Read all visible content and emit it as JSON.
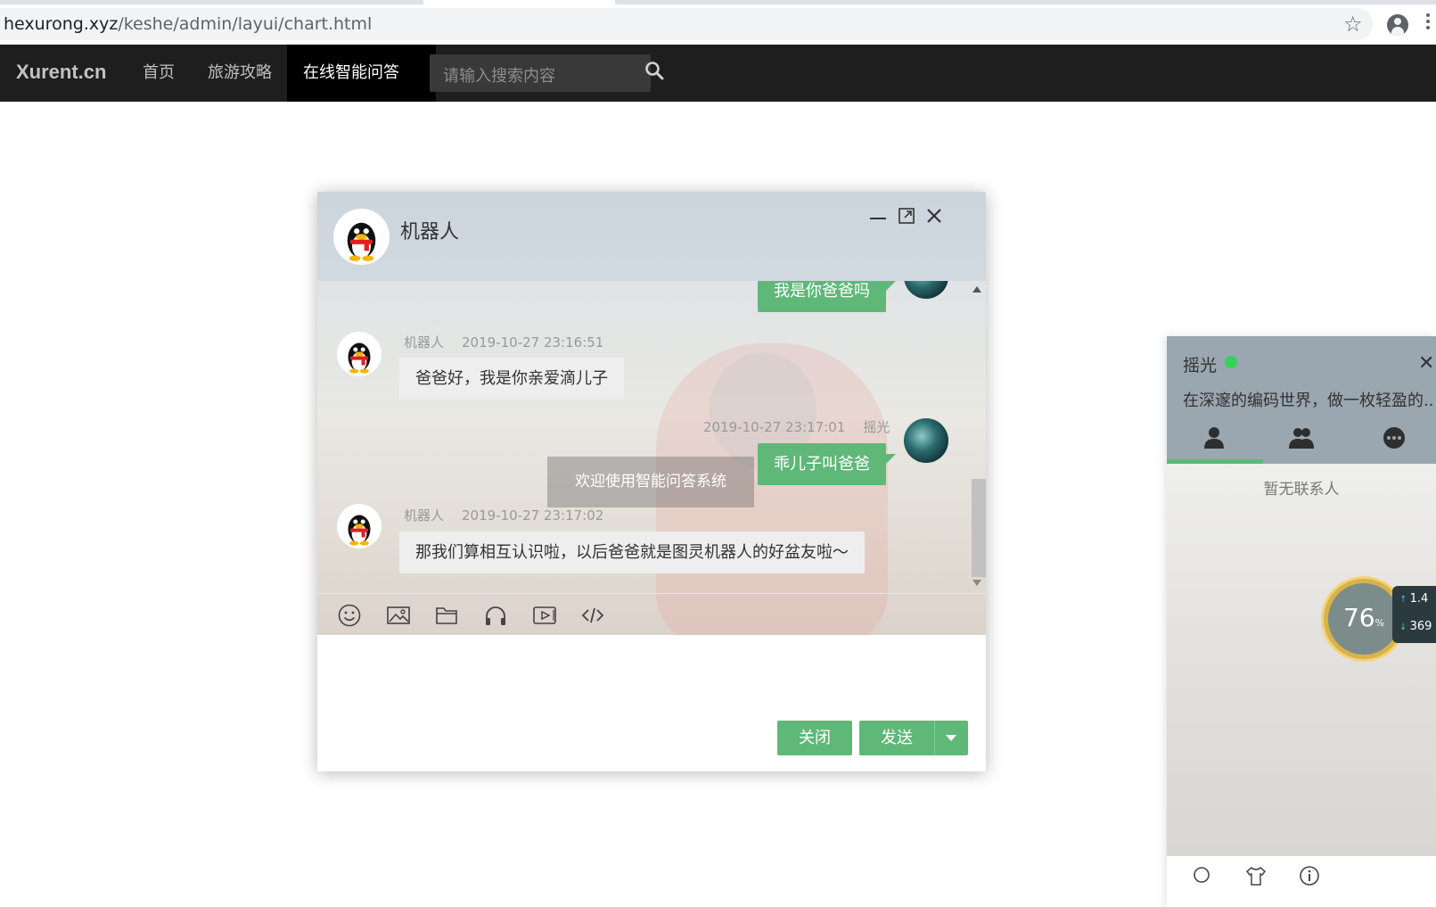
{
  "browser": {
    "url_host": "hexurong.xyz",
    "url_path": "/keshe/admin/layui/chart.html"
  },
  "nav": {
    "logo": "Xurent.cn",
    "items": [
      {
        "label": "首页"
      },
      {
        "label": "旅游攻略"
      },
      {
        "label": "在线智能问答",
        "active": true
      }
    ],
    "search_placeholder": "请输入搜索内容"
  },
  "chat": {
    "title": "机器人",
    "messages": [
      {
        "side": "right",
        "text": "我是你爸爸吗"
      },
      {
        "side": "left",
        "sender": "机器人",
        "time": "2019-10-27 23:16:51",
        "text": "爸爸好，我是你亲爱滴儿子"
      },
      {
        "side": "right",
        "sender": "摇光",
        "time": "2019-10-27 23:17:01",
        "text": "乖儿子叫爸爸"
      },
      {
        "side": "left",
        "sender": "机器人",
        "time": "2019-10-27 23:17:02",
        "text": "那我们算相互认识啦，以后爸爸就是图灵机器人的好盆友啦～"
      }
    ],
    "toast": "欢迎使用智能问答系统",
    "tools": [
      "smile-icon",
      "image-icon",
      "folder-icon",
      "headphones-icon",
      "video-icon",
      "code-icon"
    ],
    "close_label": "关闭",
    "send_label": "发送"
  },
  "contacts": {
    "username": "摇光",
    "signature": "在深邃的编码世界，做一枚轻盈的...",
    "tabs": [
      "friend-icon",
      "group-icon",
      "history-icon"
    ],
    "empty_text": "暂无联系人",
    "gauge_value": "76",
    "gauge_unit": "%",
    "net_up": "1.4",
    "net_down": "369",
    "accent": "#5fb878"
  }
}
